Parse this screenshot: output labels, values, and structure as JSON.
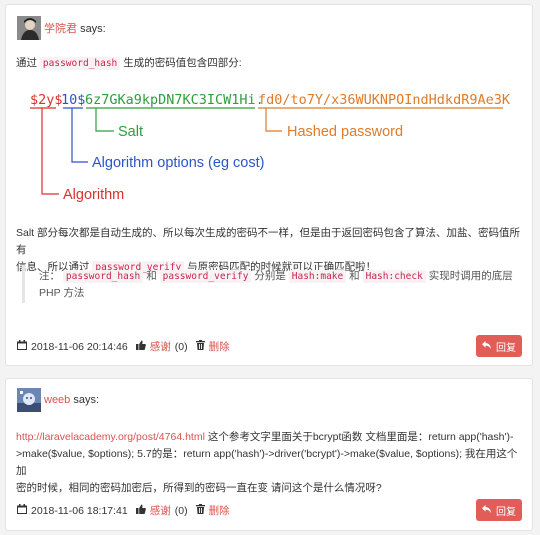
{
  "comments": [
    {
      "author": "学院君",
      "says": "says:",
      "intro_before": "通过",
      "intro_code": "password_hash",
      "intro_after": "生成的密码值包含四部分:",
      "hash": {
        "p1": "$2y$",
        "p2": "10$",
        "p3": "6z7GKa9kpDN7KC3ICW1Hi.",
        "p4": "fd0/to7Y/x36WUKNPOIndHdkdR9Ae3K",
        "label_salt": "Salt",
        "label_hashed": "Hashed password",
        "label_options": "Algorithm options (eg cost)",
        "label_algorithm": "Algorithm",
        "colors": {
          "algorithm": "#d9322b",
          "options": "#2b55c8",
          "salt": "#2e9e3c",
          "hashed": "#e07b28"
        }
      },
      "body_line1": "Salt 部分每次都是自动生成的、所以每次生成的密码不一样，但是由于返回密码包含了算法、加盐、密码值所有",
      "body_line2_before": "信息、所以通过",
      "body_line2_code": "password_verify",
      "body_line2_after": "与原密码匹配的时候就可以正确匹配啦！",
      "note_prefix": "注：",
      "note_code1": "password_hash",
      "note_and1": "和",
      "note_code2": "password_verify",
      "note_mid": "分别是",
      "note_code3": "Hash:make",
      "note_and2": "和",
      "note_code4": "Hash:check",
      "note_suffix": "实现时调用的底层",
      "note_line2": "PHP 方法",
      "timestamp": "2018-11-06 20:14:46",
      "thanks": "感谢",
      "thanks_count": "(0)",
      "delete": "删除",
      "reply": "回复"
    },
    {
      "author": "weeb",
      "says": "says:",
      "link": "http://laravelacademy.org/post/4764.html",
      "line1_after": "这个参考文字里面关于bcrypt函数 文档里面是：return app('hash')-",
      "line2": ">make($value, $options); 5.7的是：return app('hash')->driver('bcrypt')->make($value, $options); 我在用这个加",
      "line3": "密的时候，相同的密码加密后，所得到的密码一直在变 请问这个是什么情况呀?",
      "timestamp": "2018-11-06 18:17:41",
      "thanks": "感谢",
      "thanks_count": "(0)",
      "delete": "删除",
      "reply": "回复"
    }
  ]
}
